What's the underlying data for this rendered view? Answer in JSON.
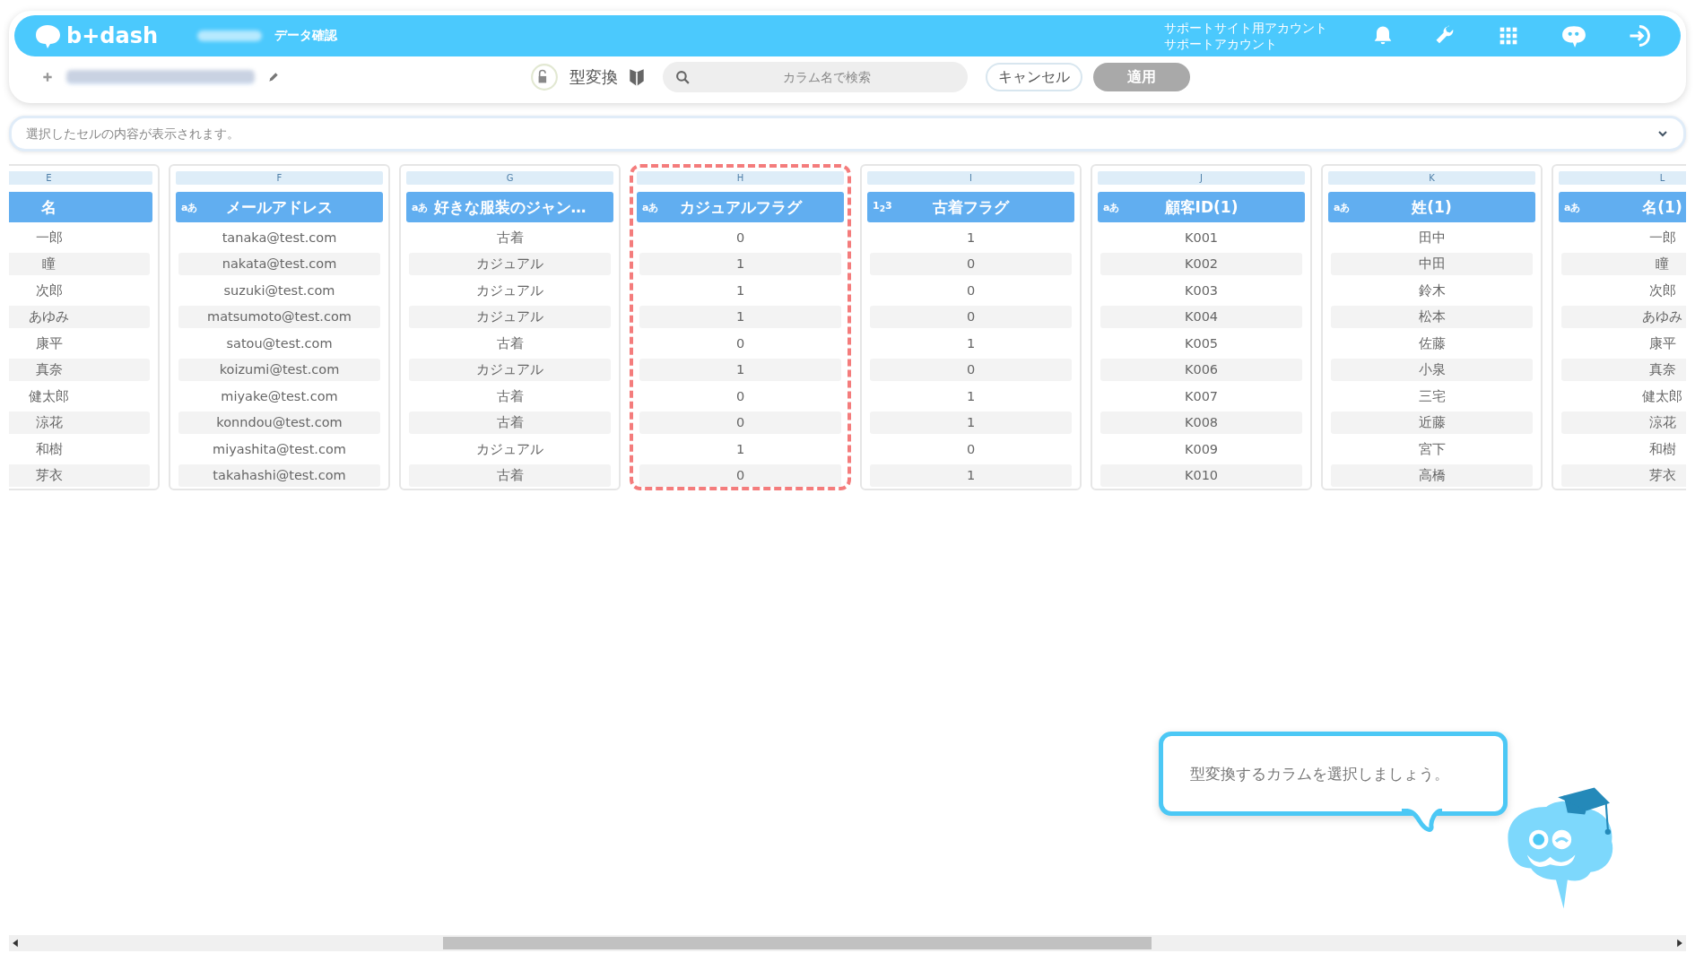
{
  "header": {
    "logo": "b+dash",
    "nav": [
      "データ確認"
    ],
    "account_lines": [
      "サポートサイト用アカウント",
      "サポートアカウント"
    ]
  },
  "toolbar": {
    "mode_label": "型変換",
    "search": {
      "placeholder": "カラム名で検索"
    },
    "buttons": [
      {
        "label": "キャンセル",
        "disabled": false
      },
      {
        "label": "適用",
        "disabled": true
      }
    ]
  },
  "cell_viewer": {
    "placeholder": "選択したセルの内容が表示されます。"
  },
  "columns": [
    {
      "letter": "E",
      "name": "名",
      "highlighted": false,
      "values": [
        "一郎",
        "瞳",
        "次郎",
        "あゆみ",
        "康平",
        "真奈",
        "健太郎",
        "涼花",
        "和樹",
        "芽衣"
      ]
    },
    {
      "letter": "F",
      "type_badge": "aあ",
      "name": "メールアドレス",
      "highlighted": false,
      "values": [
        "tanaka@test.com",
        "nakata@test.com",
        "suzuki@test.com",
        "matsumoto@test.com",
        "satou@test.com",
        "koizumi@test.com",
        "miyake@test.com",
        "konndou@test.com",
        "miyashita@test.com",
        "takahashi@test.com"
      ]
    },
    {
      "letter": "G",
      "type_badge": "aあ",
      "name": "好きな服装のジャン…",
      "highlighted": false,
      "values": [
        "古着",
        "カジュアル",
        "カジュアル",
        "カジュアル",
        "古着",
        "カジュアル",
        "古着",
        "古着",
        "カジュアル",
        "古着"
      ]
    },
    {
      "letter": "H",
      "type_badge": "aあ",
      "name": "カジュアルフラグ",
      "highlighted": true,
      "values": [
        "0",
        "1",
        "1",
        "1",
        "0",
        "1",
        "0",
        "0",
        "1",
        "0"
      ]
    },
    {
      "letter": "I",
      "type_badge": "1$_{2}$3",
      "name": "古着フラグ",
      "highlighted": false,
      "values": [
        "1",
        "0",
        "0",
        "0",
        "1",
        "0",
        "1",
        "1",
        "0",
        "1"
      ]
    },
    {
      "letter": "J",
      "type_badge": "aあ",
      "name": "顧客ID(1)",
      "highlighted": false,
      "values": [
        "K001",
        "K002",
        "K003",
        "K004",
        "K005",
        "K006",
        "K007",
        "K008",
        "K009",
        "K010"
      ]
    },
    {
      "letter": "K",
      "type_badge": "aあ",
      "name": "姓(1)",
      "highlighted": false,
      "values": [
        "田中",
        "中田",
        "鈴木",
        "松本",
        "佐藤",
        "小泉",
        "三宅",
        "近藤",
        "宮下",
        "高橋"
      ]
    },
    {
      "letter": "L",
      "type_badge": "aあ",
      "name": "名(1)",
      "highlighted": false,
      "values": [
        "一郎",
        "瞳",
        "次郎",
        "あゆみ",
        "康平",
        "真奈",
        "健太郎",
        "涼花",
        "和樹",
        "芽衣"
      ]
    }
  ],
  "tooltip": {
    "text": "型変換するカラムを選択しましょう。"
  }
}
